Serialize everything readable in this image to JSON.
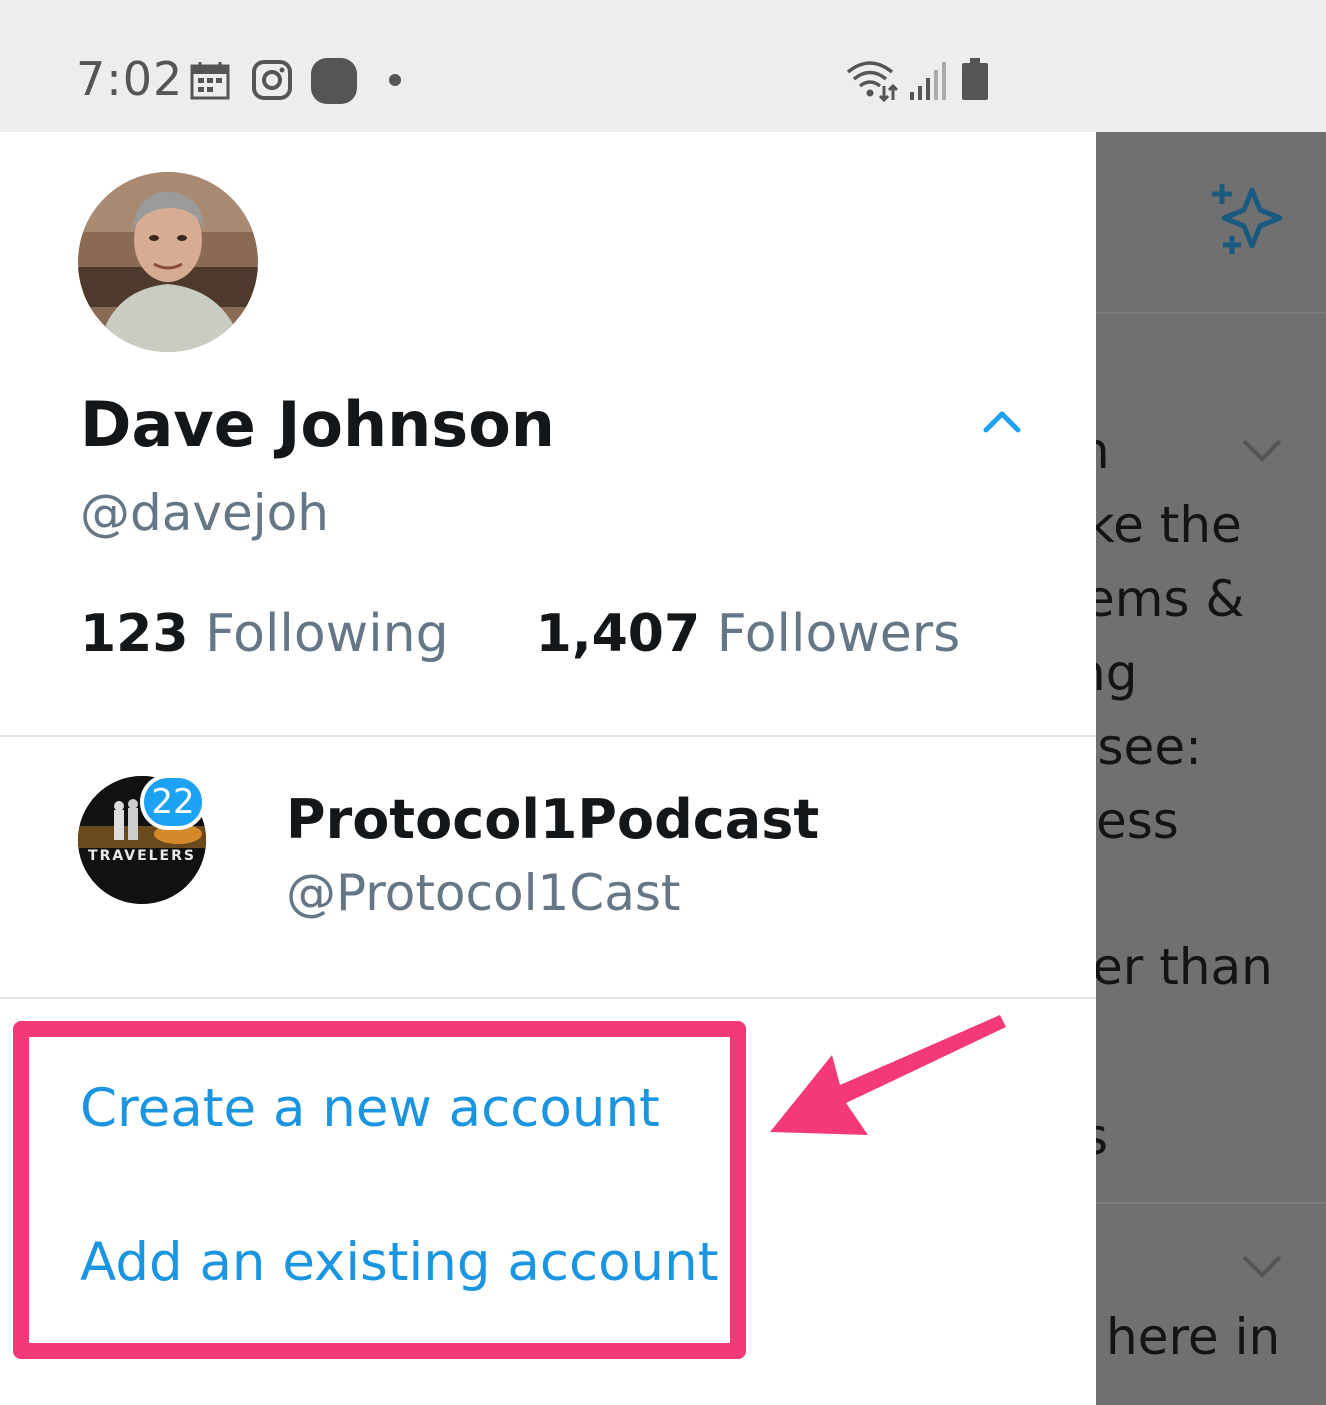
{
  "status_bar": {
    "time": "7:02",
    "icons": [
      "calendar-icon",
      "instagram-icon",
      "app-icon",
      "notification-dot",
      "wifi-icon",
      "signal-icon",
      "battery-icon"
    ]
  },
  "profile": {
    "name": "Dave Johnson",
    "handle": "@davejoh",
    "following_count": "123",
    "following_label": "Following",
    "followers_count": "1,407",
    "followers_label": "Followers"
  },
  "other_account": {
    "name": "Protocol1Podcast",
    "handle": "@Protocol1Cast",
    "badge": "22",
    "avatar_text": "TRAVELERS"
  },
  "menu": {
    "create_account": "Create a new account",
    "add_existing": "Add an existing account"
  },
  "background": {
    "lines": [
      "n",
      "ike the",
      "ems &",
      "ng",
      "(see:",
      "ess",
      "er than",
      "s",
      "here in"
    ]
  },
  "colors": {
    "accent": "#1da1f2",
    "link": "#1b95e0",
    "highlight": "#f33a77",
    "overlay": "#707070"
  }
}
